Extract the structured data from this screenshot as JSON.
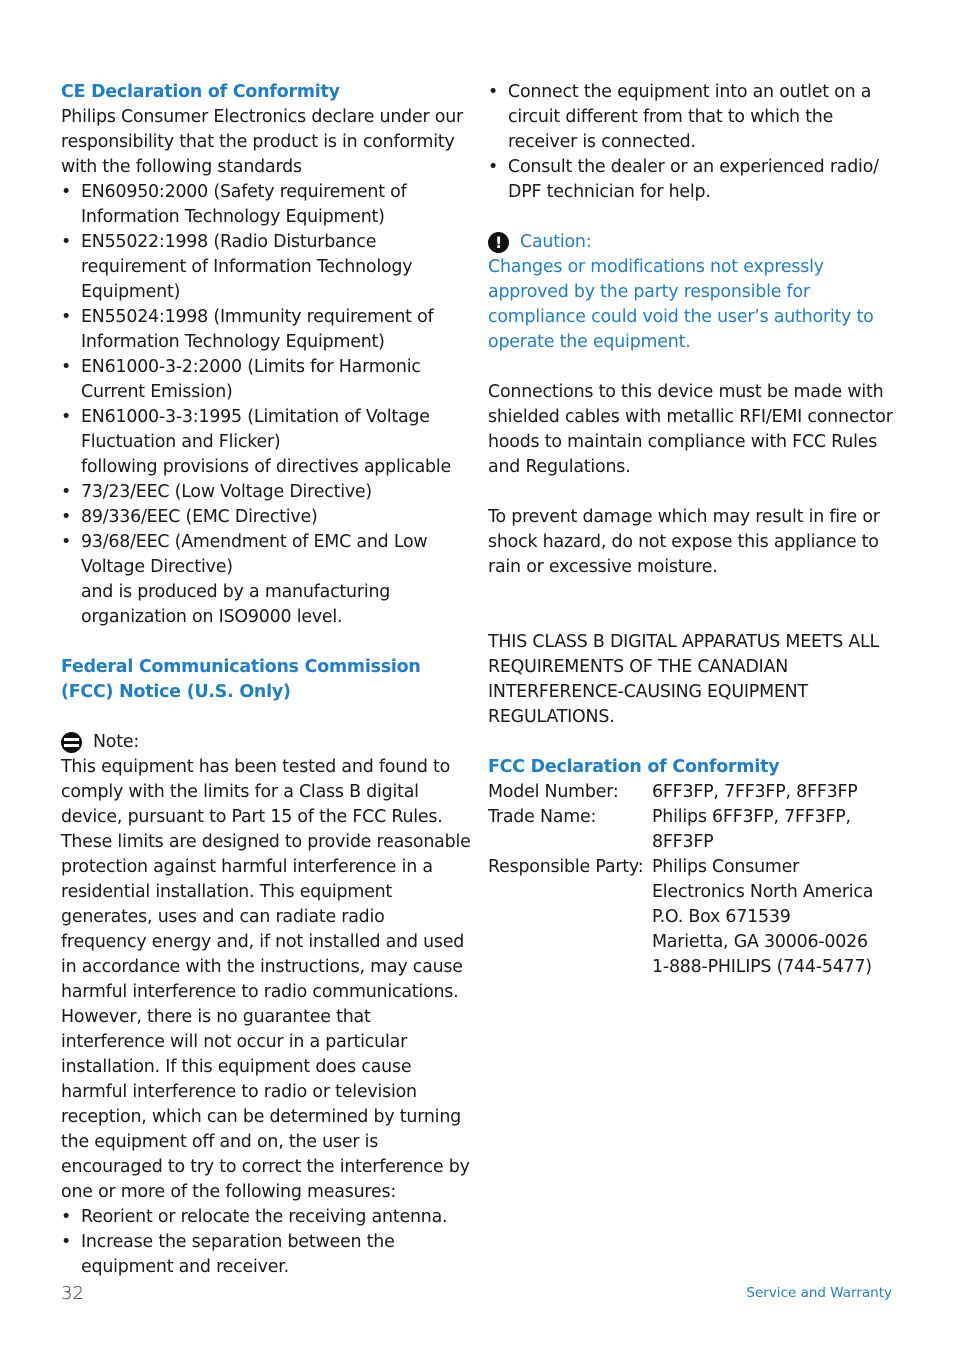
{
  "left": {
    "ce_heading": "CE Declaration of Conformity",
    "ce_intro": "Philips Consumer Electronics declare under our responsibility that the product is in conformity with the following standards",
    "standards": [
      "EN60950:2000 (Safety requirement of Information Technology Equipment)",
      "EN55022:1998 (Radio Disturbance requirement of Information Technology Equipment)",
      "EN55024:1998 (Immunity requirement of Information Technology Equipment)",
      "EN61000-3-2:2000 (Limits for Harmonic Current Emission)",
      "EN61000-3-3:1995 (Limitation of Voltage Fluctuation and Flicker)"
    ],
    "directives_intro": "following provisions of directives applicable",
    "directives": [
      "73/23/EEC (Low Voltage Directive)",
      "89/336/EEC (EMC Directive)",
      "93/68/EEC (Amendment of EMC and Low Voltage Directive)"
    ],
    "iso_text": "and is produced by a manufacturing organization on ISO9000 level.",
    "fcc_heading": "Federal Communications Commission (FCC) Notice (U.S. Only)",
    "note_label": "Note:",
    "note_body": "This equipment has been tested and found to comply with the limits for a Class B digital device, pursuant to Part 15 of the FCC Rules. These limits are designed to provide reasonable protection against harmful interference in a residential installation. This equipment generates, uses and can radiate radio frequency energy and, if not installed and used in accordance with the instructions, may cause harmful interference to radio communications. However, there is no guarantee that interference will not occur in a particular installation. If this equipment does cause harmful interference to radio or television reception, which can be determined by turning the equipment off and on, the user is encouraged to try to correct the interference by one or more of the following measures:",
    "measures": [
      "Reorient or relocate the receiving antenna.",
      "Increase the separation between the equipment and receiver."
    ]
  },
  "right": {
    "measures": [
      "Connect the equipment into an outlet on a circuit different from that to which the receiver is connected.",
      "Consult the dealer or an experienced radio/ DPF technician for help."
    ],
    "caution_label": "Caution:",
    "caution_body": "Changes or modifications not expressly approved by the party responsible for compliance could void the user’s authority to operate the equipment.",
    "connections_text": "Connections to this device must be made with shielded cables with metallic RFI/EMI connector hoods to maintain compliance with FCC Rules and Regulations.",
    "prevent_text": "To prevent damage which may result in fire or shock hazard, do not expose this appliance to rain or excessive moisture.",
    "canadian_text": "THIS CLASS B DIGITAL APPARATUS MEETS ALL REQUIREMENTS OF THE CANADIAN INTERFERENCE-CAUSING EQUIPMENT REGULATIONS.",
    "fcc_doc_heading": "FCC Declaration of Conformity",
    "model_label": "Model Number:",
    "model_value": "6FF3FP, 7FF3FP, 8FF3FP",
    "trade_label": "Trade Name:",
    "trade_value": "Philips 6FF3FP, 7FF3FP, 8FF3FP",
    "party_label": "Responsible Party:",
    "party_lines": [
      "Philips Consumer",
      "Electronics North America",
      "P.O. Box 671539",
      "Marietta, GA 30006-0026",
      "1-888-PHILIPS (744-5477)"
    ]
  },
  "footer": {
    "page_number": "32",
    "section": "Service and Warranty"
  },
  "colors": {
    "accent": "#1e7fc8",
    "text": "#1a1a1a"
  }
}
